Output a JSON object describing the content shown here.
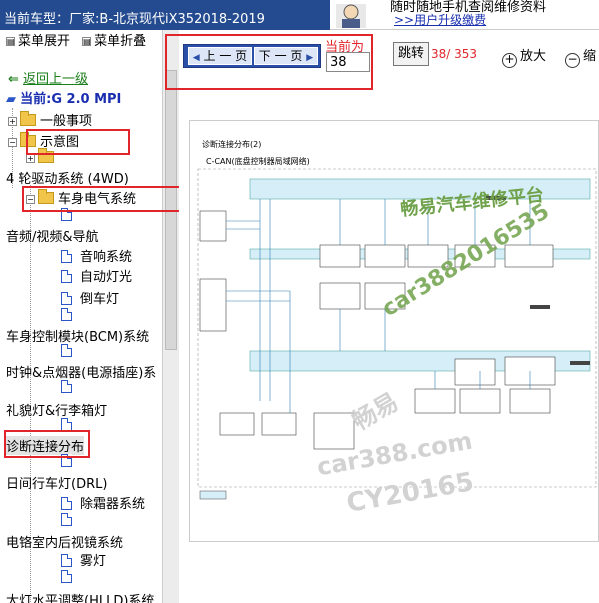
{
  "title_bar": {
    "label": "当前车型：",
    "car": "厂家:B-北京现代iX352018-2019"
  },
  "top_banner": {
    "line1": "随时随地手机查阅维修资料",
    "link": ">>用户升级缴费"
  },
  "tree": {
    "expand_all": "菜单展开",
    "collapse_all": "菜单折叠",
    "back": "返回上一级",
    "current": "当前:G 2.0 MPI",
    "items": [
      "一般事项",
      "示意图",
      "4 轮驱动系统 (4WD)",
      "车身电气系统",
      "音频/视频&导航",
      "音响系统",
      "自动灯光",
      "倒车灯",
      "车身控制模块(BCM)系统",
      "时钟&点烟器(电源插座)系",
      "礼貌灯&行李箱灯",
      "诊断连接分布",
      "日间行车灯(DRL)",
      "除霜器系统",
      "电铬室内后视镜系统",
      "雾灯",
      "大灯水平调整(HLLD)系统"
    ]
  },
  "toolbar": {
    "prev": "上 一 页",
    "next": "下 一 页",
    "current_label": "当前为",
    "page_value": "38",
    "jump": "跳转",
    "page_count": "38/ 353",
    "zoom_in": "放大",
    "zoom_out": "缩"
  },
  "diagram": {
    "title": "诊断连接分布(2)",
    "subtitle": "C-CAN(底盘控制器局域网络)"
  },
  "watermarks": {
    "w1": "畅易汽车维修平台",
    "w2": "car3882016535",
    "w3": "car388.com",
    "w4": "CY20165",
    "w5": "畅易"
  },
  "colors": {
    "accent_red": "#e0262b",
    "nav_blue": "#2a4fa8",
    "title_blue": "#244b8f",
    "watermark_green": "#6fa24a"
  }
}
